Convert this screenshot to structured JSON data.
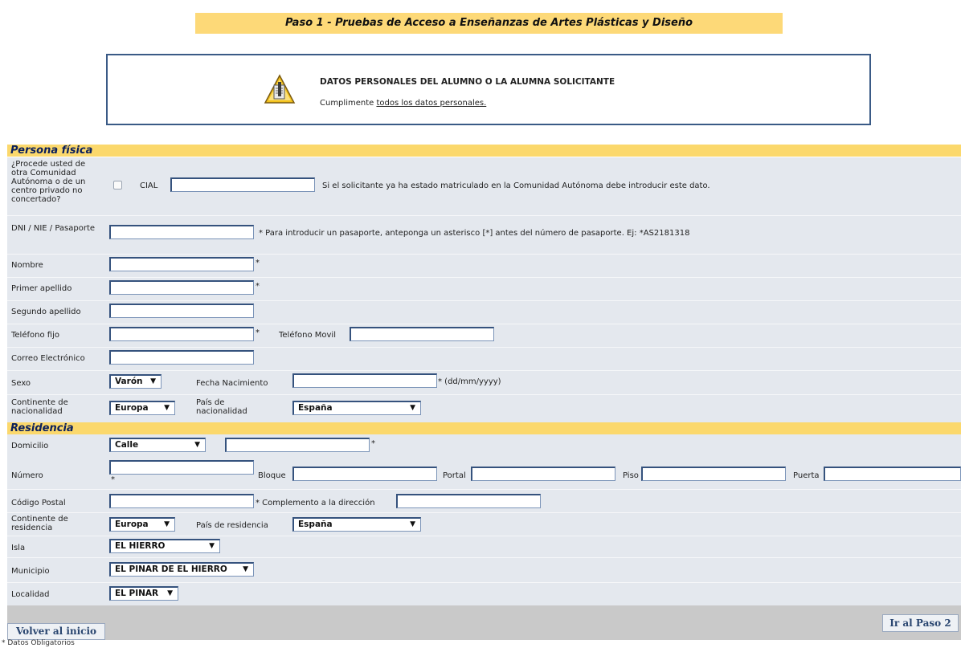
{
  "header": {
    "title": "Paso 1 - Pruebas de Acceso a Enseñanzas de Artes Plásticas y Diseño"
  },
  "notice": {
    "title": "DATOS PERSONALES DEL ALUMNO O LA ALUMNA SOLICITANTE",
    "text_prefix": "Cumplimente ",
    "text_link": "todos los datos personales.",
    "icon": "warning-icon"
  },
  "sections": {
    "persona": "Persona física",
    "residencia": "Residencia"
  },
  "persona": {
    "procede_label": "¿Procede usted de otra Comunidad Autónoma o de un centro privado no concertado?",
    "cial_label": "CIAL",
    "cial_value": "",
    "cial_note": "Si el solicitante ya ha estado matriculado en la Comunidad Autónoma debe introducir este dato.",
    "dni_label": "DNI / NIE / Pasaporte",
    "dni_value": "",
    "dni_note": "*  Para introducir un pasaporte, anteponga un asterisco [*] antes del número de pasaporte. Ej: *AS2181318",
    "nombre_label": "Nombre",
    "nombre_value": "",
    "apellido1_label": "Primer apellido",
    "apellido1_value": "",
    "apellido2_label": "Segundo apellido",
    "apellido2_value": "",
    "telefono_label": "Teléfono fijo",
    "telefono_value": "",
    "movil_label": "Teléfono Movil",
    "movil_value": "",
    "correo_label": "Correo Electrónico",
    "correo_value": "",
    "sexo_label": "Sexo",
    "sexo_value": "Varón",
    "fecha_label": "Fecha Nacimiento",
    "fecha_value": "",
    "fecha_note": "* (dd/mm/yyyy)",
    "continente_label": "Continente de nacionalidad",
    "continente_value": "Europa",
    "pais_label": "País de nacionalidad",
    "pais_value": "España"
  },
  "residencia": {
    "domicilio_label": "Domicilio",
    "via_value": "Calle",
    "domicilio_value": "",
    "numero_label": "Número",
    "numero_value": "",
    "bloque_label": "Bloque",
    "portal_label": "Portal",
    "piso_label": "Piso",
    "puerta_label": "Puerta",
    "cp_label": "Código Postal",
    "cp_value": "",
    "complemento_label": "* Complemento a la dirección",
    "complemento_value": "",
    "continente_label": "Continente de residencia",
    "continente_value": "Europa",
    "pais_label": "País de residencia",
    "pais_value": "España",
    "isla_label": "Isla",
    "isla_value": "EL HIERRO",
    "municipio_label": "Municipio",
    "municipio_value": "EL PINAR DE EL HIERRO",
    "localidad_label": "Localidad",
    "localidad_value": "EL PINAR"
  },
  "required_mark": "*",
  "dropdown_arrow": "▼",
  "buttons": {
    "back": "Volver al inicio",
    "next": "Ir al Paso 2"
  },
  "footnote": "* Datos Obligatorios"
}
